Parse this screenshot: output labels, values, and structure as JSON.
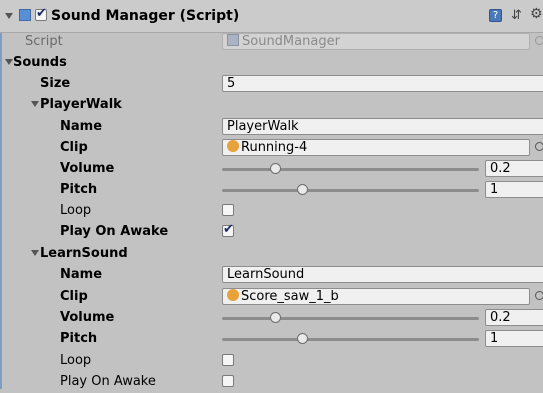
{
  "component": {
    "title": "Sound Manager (Script)",
    "enabled": true
  },
  "script": {
    "label": "Script",
    "value": "SoundManager"
  },
  "sounds": {
    "label": "Sounds",
    "size_label": "Size",
    "size_value": "5",
    "items": [
      {
        "label": "PlayerWalk",
        "name_label": "Name",
        "name_value": "PlayerWalk",
        "clip_label": "Clip",
        "clip_value": "Running-4",
        "volume_label": "Volume",
        "volume_value": "0.2",
        "pitch_label": "Pitch",
        "pitch_value": "1",
        "loop_label": "Loop",
        "loop_checked": false,
        "awake_label": "Play On Awake",
        "awake_checked": true
      },
      {
        "label": "LearnSound",
        "name_label": "Name",
        "name_value": "LearnSound",
        "clip_label": "Clip",
        "clip_value": "Score_saw_1_b",
        "volume_label": "Volume",
        "volume_value": "0.2",
        "pitch_label": "Pitch",
        "pitch_value": "1",
        "loop_label": "Loop",
        "loop_checked": false,
        "awake_label": "Play On Awake",
        "awake_checked": false
      }
    ]
  }
}
